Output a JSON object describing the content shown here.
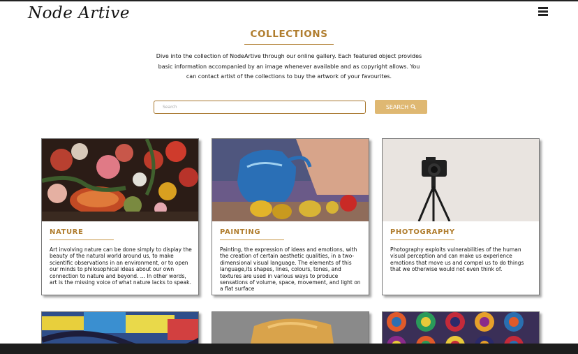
{
  "header": {
    "logo_text": "Node Artive",
    "menu_icon": "hamburger-icon"
  },
  "page": {
    "title": "COLLECTIONS",
    "intro_line1": "Dive into the collection of NodeArtive through our online gallery. Each featured object provides",
    "intro_line2": "basic information accompanied by an image whenever available and as copyright allows. You",
    "intro_line3": "can contact artist of the collections to buy the artwork of your favourites."
  },
  "search": {
    "placeholder": "Search",
    "button_label": "SEARCH",
    "button_icon": "search-icon"
  },
  "cards": [
    {
      "title": "NATURE",
      "text": "Art involving nature can be done simply to display the beauty of the natural world around us, to make scientific observations in an environment, or to open our minds to philosophical ideas about our own connection to nature and beyond. ... In other words, art is the missing voice of what nature lacks to speak."
    },
    {
      "title": "PAINTING",
      "text": "Painting, the expression of ideas and emotions, with the creation of certain aesthetic qualities, in a two-dimensional visual language. The elements of this language,its shapes, lines, colours, tones, and textures are used in various ways to produce sensations of volume, space, movement, and light on a flat surface"
    },
    {
      "title": "PHOTOGRAPHY",
      "text": "Photography exploits vulnerabilities of the human visual perception and can make us experience emotions that move us and compel us to do things that we otherwise would not even think of."
    }
  ],
  "colors": {
    "accent": "#b07d2e",
    "button": "#dfb872",
    "footer": "#1d1d1d"
  }
}
